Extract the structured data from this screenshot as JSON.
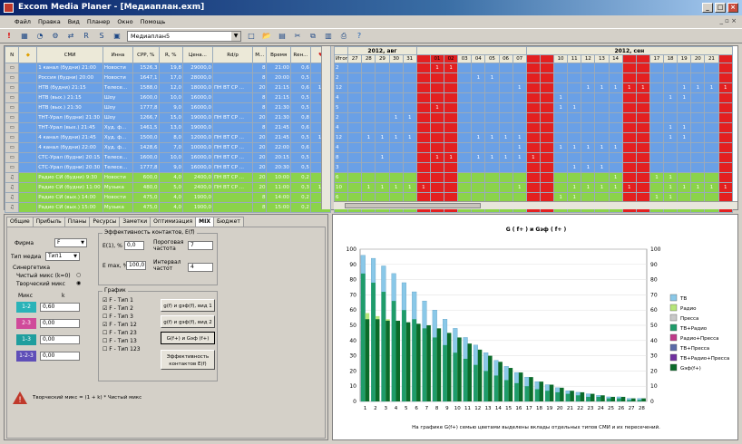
{
  "window": {
    "title": "Excom Media Planer - [Медиаплан.exm]"
  },
  "menu": [
    "Файл",
    "Правка",
    "Вид",
    "Планер",
    "Окно",
    "Помощь"
  ],
  "toolbar": {
    "select_value": "Медиаплан5"
  },
  "grid": {
    "columns": [
      "N",
      "",
      "СМИ",
      "Инна",
      "CPP, %",
      "R, %",
      "Цена...",
      "Rd/p",
      "М...",
      "Время",
      "Rен...",
      ""
    ],
    "rows": [
      {
        "smi": "1 канал (будни) 21:00",
        "genre": "Новости",
        "cpp": "1526,3",
        "r": "19,8",
        "price": "29000,0",
        "rdp": "",
        "m": "8",
        "time": "21:00",
        "ren": "0,6",
        "last": "2,8",
        "color": "blue"
      },
      {
        "smi": "Россия (будни) 20:00",
        "genre": "Новости",
        "cpp": "1647,1",
        "r": "17,0",
        "price": "28000,0",
        "rdp": "",
        "m": "8",
        "time": "20:00",
        "ren": "0,5",
        "last": "2,8",
        "color": "blue"
      },
      {
        "smi": "НТВ (будни) 21:15",
        "genre": "Телесе...",
        "cpp": "1588,0",
        "r": "12,0",
        "price": "18000,0",
        "rdp": "ПН ВТ СР ...",
        "m": "20",
        "time": "21:15",
        "ren": "0,6",
        "last": "12,0",
        "color": "blue"
      },
      {
        "smi": "НТВ (вых.) 21:15",
        "genre": "Шоу",
        "cpp": "1600,0",
        "r": "10,0",
        "price": "16000,0",
        "rdp": "",
        "m": "8",
        "time": "21:15",
        "ren": "0,5",
        "last": "4,0",
        "color": "blue"
      },
      {
        "smi": "НТВ (вых.) 21:30",
        "genre": "Шоу",
        "cpp": "1777,8",
        "r": "9,0",
        "price": "16000,0",
        "rdp": "",
        "m": "8",
        "time": "21:30",
        "ren": "0,5",
        "last": "4,0",
        "color": "blue"
      },
      {
        "smi": "ТНТ-Урал (будни) 21:30",
        "genre": "Шоу",
        "cpp": "1266,7",
        "r": "15,0",
        "price": "19000,0",
        "rdp": "ПН ВТ СР ...",
        "m": "20",
        "time": "21:30",
        "ren": "0,8",
        "last": "2,0",
        "color": "blue"
      },
      {
        "smi": "ТНТ-Урал (вых.) 21:45",
        "genre": "Худ. ф...",
        "cpp": "1461,5",
        "r": "13,0",
        "price": "19000,0",
        "rdp": "",
        "m": "8",
        "time": "21:45",
        "ren": "0,6",
        "last": "4,0",
        "color": "blue"
      },
      {
        "smi": "4 канал (будни) 21:45",
        "genre": "Худ. ф...",
        "cpp": "1500,0",
        "r": "8,0",
        "price": "12000,0",
        "rdp": "ПН ВТ СР ...",
        "m": "20",
        "time": "21:45",
        "ren": "0,5",
        "last": "12,0",
        "color": "blue"
      },
      {
        "smi": "4 канал (будни) 22:00",
        "genre": "Худ. ф...",
        "cpp": "1428,6",
        "r": "7,0",
        "price": "10000,0",
        "rdp": "ПН ВТ СР ...",
        "m": "20",
        "time": "22:00",
        "ren": "0,6",
        "last": "7,0",
        "color": "blue"
      },
      {
        "smi": "СТС-Урал (будни) 20:15",
        "genre": "Телесе...",
        "cpp": "1600,0",
        "r": "10,0",
        "price": "16000,0",
        "rdp": "ПН ВТ СР ...",
        "m": "20",
        "time": "20:15",
        "ren": "0,5",
        "last": "8,0",
        "color": "blue"
      },
      {
        "smi": "СТС-Урал (будни) 20:30",
        "genre": "Телесе...",
        "cpp": "1777,8",
        "r": "9,0",
        "price": "16000,0",
        "rdp": "ПН ВТ СР ...",
        "m": "20",
        "time": "20:30",
        "ren": "0,5",
        "last": "3,0",
        "color": "blue"
      },
      {
        "smi": "Радио СИ (будни) 9:30",
        "genre": "Новости",
        "cpp": "600,0",
        "r": "4,0",
        "price": "2400,0",
        "rdp": "ПН ВТ СР ...",
        "m": "20",
        "time": "10:00",
        "ren": "0,2",
        "last": "6,0",
        "color": "green"
      },
      {
        "smi": "Радио СИ (будни) 11:00",
        "genre": "Музыка",
        "cpp": "480,0",
        "r": "5,0",
        "price": "2400,0",
        "rdp": "ПН ВТ СР ...",
        "m": "20",
        "time": "11:00",
        "ren": "0,3",
        "last": "10,0",
        "color": "green"
      },
      {
        "smi": "Радио СИ (вых.) 14:00",
        "genre": "Новости",
        "cpp": "475,0",
        "r": "4,0",
        "price": "1900,0",
        "rdp": "",
        "m": "8",
        "time": "14:00",
        "ren": "0,2",
        "last": "6,0",
        "color": "green"
      },
      {
        "smi": "Радио СИ (вых.) 15:00",
        "genre": "Музыка",
        "cpp": "475,0",
        "r": "4,0",
        "price": "1900,0",
        "rdp": "",
        "m": "8",
        "time": "15:00",
        "ren": "0,2",
        "last": "6,0",
        "color": "green"
      }
    ],
    "plan": {
      "month1": "2012, авг",
      "month2": "2012, сен",
      "total_label": "Итого",
      "days": [
        "27",
        "28",
        "29",
        "30",
        "31",
        "",
        "01",
        "02",
        "03",
        "04",
        "05",
        "06",
        "07",
        "",
        "",
        "10",
        "11",
        "12",
        "13",
        "14",
        "",
        "",
        "17",
        "18",
        "19",
        "20",
        "21",
        ""
      ],
      "red_cols": [
        5,
        6,
        7,
        13,
        14,
        20,
        21,
        27
      ],
      "totals": [
        "2",
        "2",
        "12",
        "4",
        "5",
        "2",
        "4",
        "12",
        "4",
        "8",
        "3",
        "6",
        "10",
        "6",
        "4"
      ],
      "marks": [
        [
          6,
          7
        ],
        [
          9,
          10
        ],
        [
          12,
          17,
          18,
          19,
          20,
          21,
          24,
          25,
          26,
          27
        ],
        [
          23,
          24,
          15
        ],
        [
          6,
          15,
          16
        ],
        [
          3,
          4
        ],
        [
          23,
          24
        ],
        [
          1,
          2,
          3,
          4,
          9,
          10,
          11,
          12,
          23,
          24
        ],
        [
          12,
          15,
          16,
          17,
          18,
          19
        ],
        [
          2,
          6,
          7,
          9,
          10,
          11,
          12,
          13
        ],
        [
          16,
          17,
          18
        ],
        [
          19,
          22,
          23
        ],
        [
          1,
          2,
          3,
          4,
          5,
          12,
          16,
          17,
          18,
          19,
          20,
          23,
          24,
          25,
          26,
          27
        ],
        [
          15,
          16,
          22,
          23
        ],
        [
          20,
          23
        ]
      ]
    }
  },
  "panel": {
    "tabs": [
      "Общие",
      "Прибыль",
      "Планы",
      "Ресурсы",
      "Заметки",
      "Оптимизация",
      "MIX",
      "Бюджет"
    ],
    "active_tab": "MIX",
    "firm_label": "Фирма",
    "firm_value": "F",
    "type_label": "Тип медиа",
    "type_value": "Тип1",
    "synergy_label": "Синергетика",
    "pure_mix": "Чистый микс (k=0)",
    "creative_mix": "Творческий микс",
    "mix_header": "Микс",
    "k_header": "k",
    "mix_rows": [
      {
        "label": "1-2",
        "value": "0,60",
        "color": "#2ab3b8"
      },
      {
        "label": "2-3",
        "value": "0,00",
        "color": "#d04a9a"
      },
      {
        "label": "1-3",
        "value": "0,00",
        "color": "#1f9e9e"
      },
      {
        "label": "1-2-3",
        "value": "0,00",
        "color": "#5f4fb8"
      }
    ],
    "eff_title": "Эффективность контактов, E(f)",
    "e1_label": "E(1), %",
    "e1_value": "0,0",
    "thresh_label": "Пороговая частота",
    "thresh_value": "7",
    "emax_label": "E max, %",
    "emax_value": "100,0",
    "interval_label": "Интервал частот",
    "interval_value": "4",
    "chart_title_group": "График",
    "series_checks": [
      {
        "label": "F - Тип 1",
        "checked": true
      },
      {
        "label": "F - Тип 2",
        "checked": true
      },
      {
        "label": "F - Тип 3",
        "checked": false
      },
      {
        "label": "F - Тип 12",
        "checked": true
      },
      {
        "label": "F - Тип 23",
        "checked": false
      },
      {
        "label": "F - Тип 13",
        "checked": false
      },
      {
        "label": "F - Тип 123",
        "checked": false
      }
    ],
    "btn1": "g(f) и gэф(f), вид 1",
    "btn2": "g(f) и gэф(f), вид 2",
    "btn3": "G(f+) и Gэф (f+)",
    "btn4": "Эффективность контактов E(f)",
    "formula": "Творческий микс = (1 + k) * Чистый микс"
  },
  "chart_data": {
    "type": "bar",
    "title": "G ( f+ ) и Gэф ( f+ )",
    "categories": [
      "1",
      "2",
      "3",
      "4",
      "5",
      "6",
      "7",
      "8",
      "9",
      "10",
      "11",
      "12",
      "13",
      "14",
      "15",
      "16",
      "17",
      "18",
      "19",
      "20",
      "21",
      "22",
      "23",
      "24",
      "25",
      "26",
      "27",
      "28"
    ],
    "ylim": [
      0,
      100
    ],
    "yticks": [
      0,
      10,
      20,
      30,
      40,
      50,
      60,
      70,
      80,
      90,
      100
    ],
    "series": [
      {
        "name": "ТВ",
        "color": "#8ac8e8",
        "values": [
          96,
          94,
          89,
          84,
          78,
          72,
          66,
          60,
          54,
          48,
          42,
          37,
          32,
          27,
          23,
          19,
          16,
          13,
          11,
          9,
          7,
          6,
          5,
          4,
          3,
          3,
          2,
          2
        ]
      },
      {
        "name": "Радио",
        "color": "#b6e57a",
        "values": [
          58,
          56,
          54,
          52,
          50,
          47,
          44,
          40,
          36,
          32,
          28,
          24,
          20,
          17,
          14,
          11,
          9,
          7,
          6,
          5,
          4,
          3,
          3,
          2,
          2,
          1,
          1,
          1
        ]
      },
      {
        "name": "Пресса",
        "color": "#c8c8c8",
        "values": [
          0,
          0,
          0,
          0,
          0,
          0,
          0,
          0,
          0,
          0,
          0,
          0,
          0,
          0,
          0,
          0,
          0,
          0,
          0,
          0,
          0,
          0,
          0,
          0,
          0,
          0,
          0,
          0
        ]
      },
      {
        "name": "ТВ+Радио",
        "color": "#1f9c6a",
        "values": [
          84,
          78,
          72,
          66,
          60,
          54,
          48,
          42,
          37,
          32,
          28,
          24,
          20,
          17,
          14,
          12,
          10,
          8,
          7,
          6,
          5,
          4,
          3,
          3,
          2,
          2,
          1,
          1
        ]
      },
      {
        "name": "Радио+Пресса",
        "color": "#c03a8a",
        "values": [
          0,
          0,
          0,
          0,
          0,
          0,
          0,
          0,
          0,
          0,
          0,
          0,
          0,
          0,
          0,
          0,
          0,
          0,
          0,
          0,
          0,
          0,
          0,
          0,
          0,
          0,
          0,
          0
        ]
      },
      {
        "name": "ТВ+Пресса",
        "color": "#5a6aa8",
        "values": [
          0,
          0,
          0,
          0,
          0,
          0,
          0,
          0,
          0,
          0,
          0,
          0,
          0,
          0,
          0,
          0,
          0,
          0,
          0,
          0,
          0,
          0,
          0,
          0,
          0,
          0,
          0,
          0
        ]
      },
      {
        "name": "ТВ+Радио+Пресса",
        "color": "#7030a0",
        "values": [
          0,
          0,
          0,
          0,
          0,
          0,
          0,
          0,
          0,
          0,
          0,
          0,
          0,
          0,
          0,
          0,
          0,
          0,
          0,
          0,
          0,
          0,
          0,
          0,
          0,
          0,
          0,
          0
        ]
      },
      {
        "name": "Gэф(f+)",
        "color": "#0b6b2a",
        "values": [
          54,
          54,
          53,
          53,
          52,
          51,
          50,
          48,
          45,
          42,
          38,
          34,
          30,
          26,
          22,
          19,
          16,
          13,
          11,
          9,
          7,
          6,
          5,
          4,
          3,
          3,
          2,
          2
        ]
      }
    ],
    "note": "На графике G(f+) семью цветами выделены вклады отдельных типов СМИ и их пересечений."
  }
}
